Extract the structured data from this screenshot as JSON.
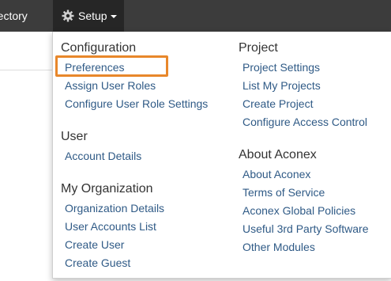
{
  "navbar": {
    "directory_label": "rectory",
    "setup_label": "Setup"
  },
  "dropdown": {
    "configuration": {
      "heading": "Configuration",
      "items": [
        "Preferences",
        "Assign User Roles",
        "Configure User Role Settings"
      ]
    },
    "user": {
      "heading": "User",
      "items": [
        "Account Details"
      ]
    },
    "my_organization": {
      "heading": "My Organization",
      "items": [
        "Organization Details",
        "User Accounts List",
        "Create User",
        "Create Guest"
      ]
    },
    "project": {
      "heading": "Project",
      "items": [
        "Project Settings",
        "List My Projects",
        "Create Project",
        "Configure Access Control"
      ]
    },
    "about": {
      "heading": "About Aconex",
      "items": [
        "About Aconex",
        "Terms of Service",
        "Aconex Global Policies",
        "Useful 3rd Party Software",
        "Other Modules"
      ]
    }
  },
  "colors": {
    "navbar": "#3c3c3c",
    "setup_active": "#262626",
    "link": "#2f5a86",
    "heading": "#333333",
    "highlight": "#e8872b"
  }
}
